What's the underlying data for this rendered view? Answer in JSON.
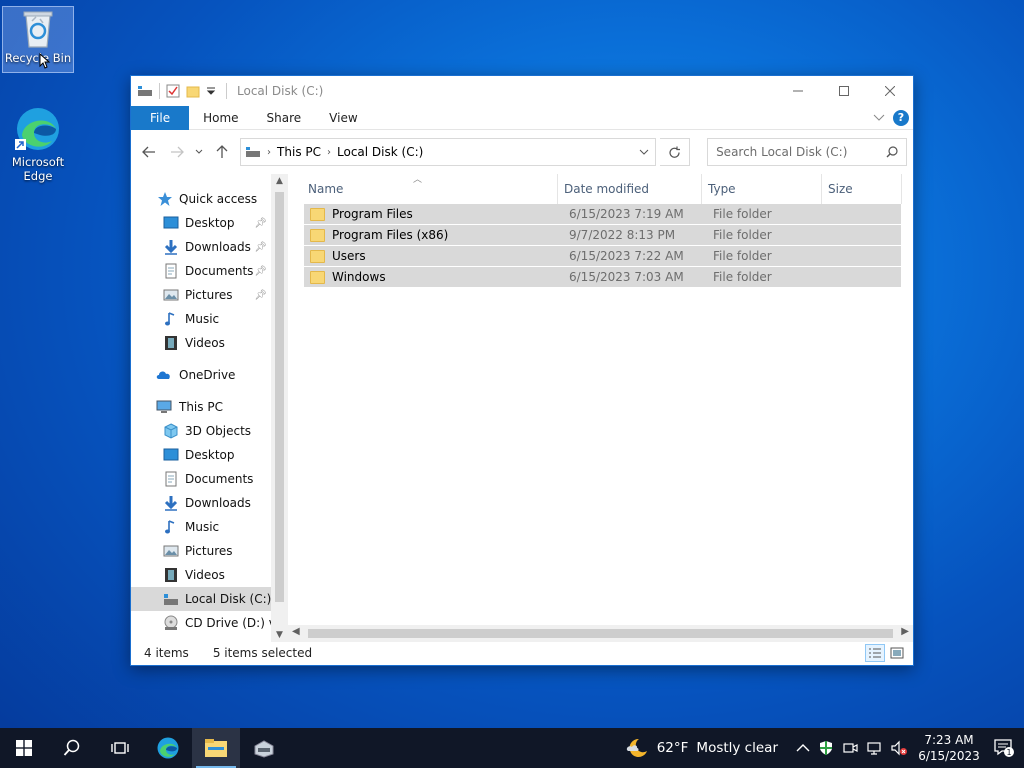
{
  "desktop": {
    "icons": [
      {
        "label": "Recycle Bin"
      },
      {
        "label": "Microsoft Edge"
      }
    ]
  },
  "window": {
    "title": "Local Disk (C:)",
    "ribbon": {
      "file": "File",
      "home": "Home",
      "share": "Share",
      "view": "View"
    },
    "address": {
      "segments": [
        "This PC",
        "Local Disk (C:)"
      ]
    },
    "search": {
      "placeholder": "Search Local Disk (C:)"
    },
    "nav": {
      "quick_access": "Quick access",
      "qa_items": [
        "Desktop",
        "Downloads",
        "Documents",
        "Pictures",
        "Music",
        "Videos"
      ],
      "onedrive": "OneDrive",
      "this_pc": "This PC",
      "pc_items": [
        "3D Objects",
        "Desktop",
        "Documents",
        "Downloads",
        "Music",
        "Pictures",
        "Videos",
        "Local Disk (C:)",
        "CD Drive (D:) virt"
      ]
    },
    "columns": {
      "name": "Name",
      "date": "Date modified",
      "type": "Type",
      "size": "Size"
    },
    "files": [
      {
        "name": "Program Files",
        "date": "6/15/2023 7:19 AM",
        "type": "File folder"
      },
      {
        "name": "Program Files (x86)",
        "date": "9/7/2022 8:13 PM",
        "type": "File folder"
      },
      {
        "name": "Users",
        "date": "6/15/2023 7:22 AM",
        "type": "File folder"
      },
      {
        "name": "Windows",
        "date": "6/15/2023 7:03 AM",
        "type": "File folder"
      }
    ],
    "status": {
      "count": "4 items",
      "selected": "5 items selected"
    }
  },
  "taskbar": {
    "weather": {
      "temp": "62°F",
      "desc": "Mostly clear"
    },
    "clock": {
      "time": "7:23 AM",
      "date": "6/15/2023"
    },
    "notification_count": "1"
  }
}
